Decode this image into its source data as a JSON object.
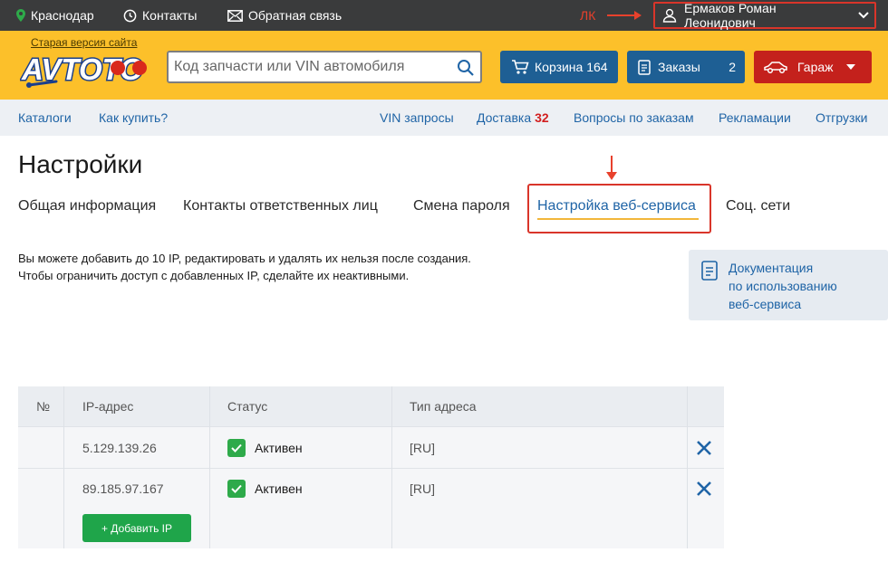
{
  "topbar": {
    "city": "Краснодар",
    "contacts": "Контакты",
    "feedback": "Обратная связь",
    "annotation_lk": "ЛК",
    "user_name": "Ермаков Роман Леонидович"
  },
  "header": {
    "old_site_link": "Старая версия сайта",
    "logo_text": "AVTOTO",
    "search_placeholder": "Код запчасти или VIN автомобиля",
    "cart_label": "Корзина 164",
    "orders_label": "Заказы",
    "orders_count": "2",
    "garage_label": "Гараж"
  },
  "nav": {
    "catalogs": "Каталоги",
    "how_to_buy": "Как купить?",
    "vin_requests": "VIN запросы",
    "delivery": "Доставка",
    "delivery_count": "32",
    "order_questions": "Вопросы по заказам",
    "claims": "Рекламации",
    "shipments": "Отгрузки"
  },
  "page": {
    "title": "Настройки",
    "tabs": [
      {
        "label": "Общая информация"
      },
      {
        "label": "Контакты ответственных лиц"
      },
      {
        "label": "Смена пароля"
      },
      {
        "label": "Настройка веб-сервиса"
      },
      {
        "label": "Соц. сети"
      }
    ],
    "active_tab": "Настройка веб-сервиса",
    "info_line1": "Вы можете добавить до 10 IP, редактировать и удалять их нельзя после создания.",
    "info_line2": "Чтобы ограничить доступ с добавленных IP, сделайте их неактивными.",
    "doc_line1": "Документация",
    "doc_line2": "по использованию",
    "doc_line3": "веб-сервиса"
  },
  "table": {
    "headers": {
      "num": "№",
      "ip": "IP-адрес",
      "status": "Статус",
      "type": "Тип адреса"
    },
    "rows": [
      {
        "ip": "5.129.139.26",
        "status": "Активен",
        "type": "[RU]",
        "active": true
      },
      {
        "ip": "89.185.97.167",
        "status": "Активен",
        "type": "[RU]",
        "active": true
      }
    ],
    "add_button": "+ Добавить IP"
  },
  "colors": {
    "header_yellow": "#fcc02a",
    "topbar_dark": "#3a3b3c",
    "primary_blue": "#1e5f94",
    "garage_red": "#c4211c",
    "active_green": "#2eaa4a",
    "annotation_red": "#d9352a"
  },
  "icons": [
    "location-pin-icon",
    "clock-icon",
    "mail-icon",
    "user-icon",
    "chevron-down-icon",
    "search-icon",
    "cart-icon",
    "document-icon",
    "car-icon",
    "checkmark-icon",
    "close-icon"
  ]
}
